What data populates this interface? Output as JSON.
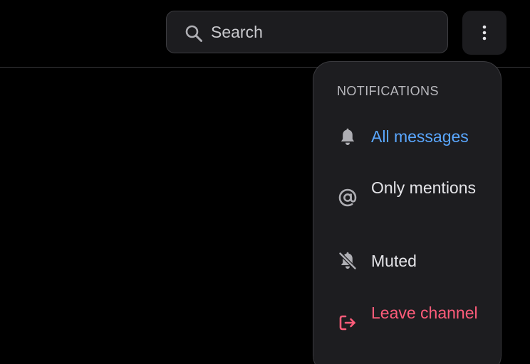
{
  "search": {
    "placeholder": "Search",
    "value": ""
  },
  "header": {
    "more_icon": "vertical-ellipsis-icon"
  },
  "notifications_menu": {
    "header": "NOTIFICATIONS",
    "items": [
      {
        "label": "All messages",
        "icon": "bell-icon",
        "selected": true,
        "color": "#5aa7ff"
      },
      {
        "label": "Only mentions",
        "icon": "at-sign-icon",
        "selected": false,
        "color": "#e4e4e8"
      },
      {
        "label": "Muted",
        "icon": "bell-off-icon",
        "selected": false,
        "color": "#e4e4e8"
      },
      {
        "label": "Leave channel",
        "icon": "logout-icon",
        "selected": false,
        "color": "#ff5c7a"
      }
    ]
  },
  "colors": {
    "background": "#000000",
    "surface": "#1d1d20",
    "accent": "#5aa7ff",
    "danger": "#ff5c7a",
    "icon": "#aeaeb3"
  }
}
